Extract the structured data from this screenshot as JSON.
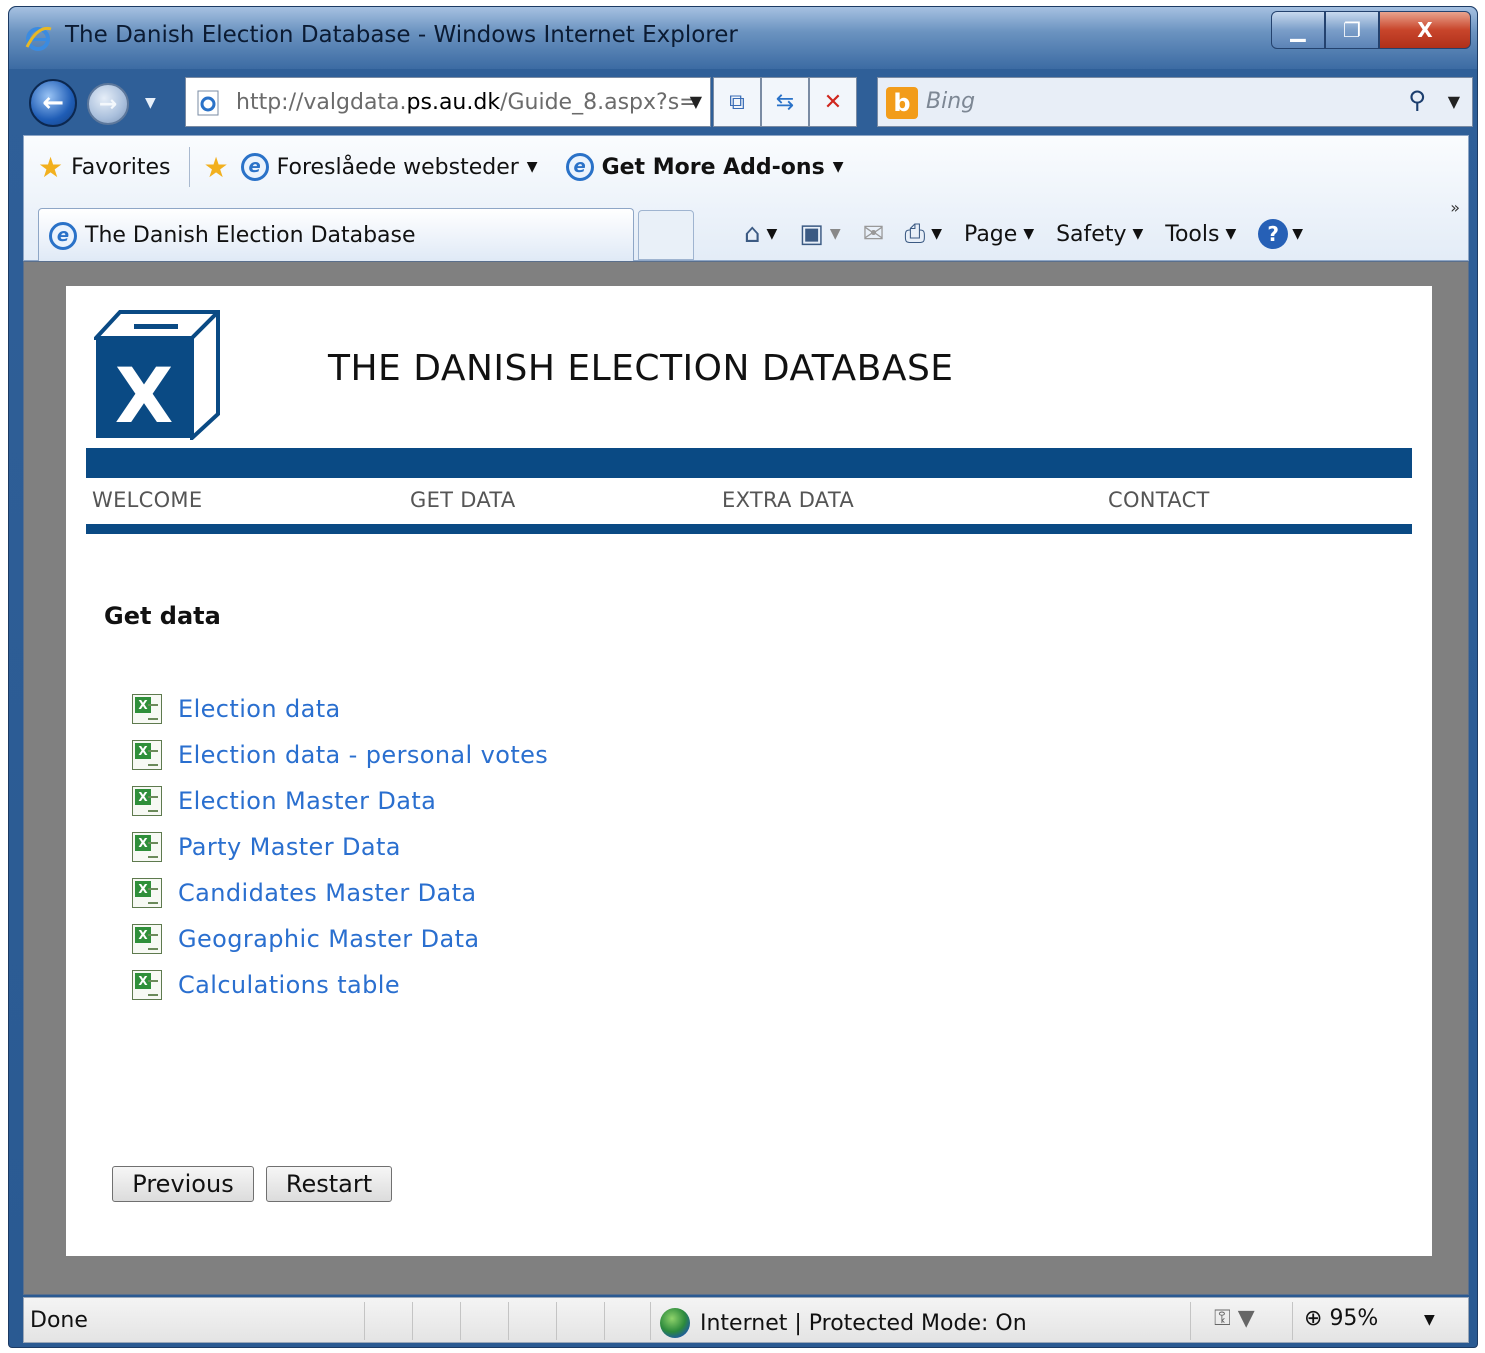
{
  "window": {
    "title": "The Danish Election Database - Windows Internet Explorer",
    "controls": {
      "minimize": "▁",
      "maximize": "❐",
      "close": "X"
    }
  },
  "address_bar": {
    "url_prefix": "http://valgdata.",
    "url_domain": "ps.au.dk",
    "url_suffix": "/Guide_8.aspx?s=",
    "compat_icon": "compatibility-view-icon",
    "refresh_icon": "refresh-icon",
    "stop_icon": "stop-icon"
  },
  "search": {
    "placeholder": "Bing",
    "engine_logo": "b"
  },
  "favorites_bar": {
    "favorites_label": "Favorites",
    "suggested_sites_label": "Foreslåede websteder",
    "addons_label": "Get More Add-ons"
  },
  "tab": {
    "title": "The Danish Election Database"
  },
  "command_bar": {
    "page_label": "Page",
    "safety_label": "Safety",
    "tools_label": "Tools",
    "help_label": "?"
  },
  "site": {
    "logo_letter": "X",
    "title": "THE DANISH ELECTION DATABASE",
    "nav": [
      "WELCOME",
      "GET DATA",
      "EXTRA DATA",
      "CONTACT"
    ],
    "section_heading": "Get data",
    "links": [
      "Election data",
      "Election data - personal votes",
      "Election Master Data",
      "Party Master Data",
      "Candidates Master Data",
      "Geographic Master Data",
      "Calculations table"
    ],
    "buttons": {
      "previous": "Previous",
      "restart": "Restart"
    }
  },
  "status_bar": {
    "status": "Done",
    "zone": "Internet | Protected Mode: On",
    "zoom": "95%"
  },
  "colors": {
    "site_band": "#0a4a84",
    "link": "#2a6fcf",
    "viewport_bg": "#808080"
  }
}
